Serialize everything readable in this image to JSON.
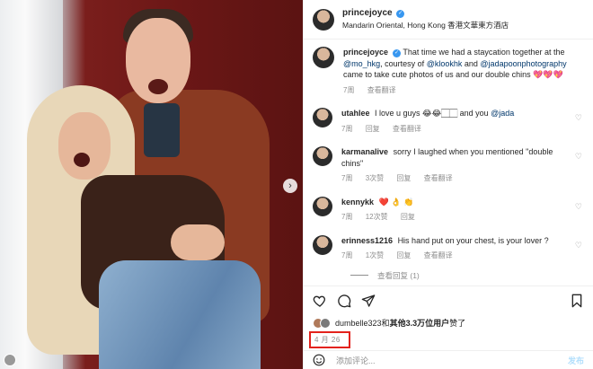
{
  "post": {
    "username": "princejoyce",
    "location": "Mandarin Oriental, Hong Kong 香港文華東方酒店"
  },
  "caption": {
    "username": "princejoyce",
    "text_a": "That time we had a staycation together at the",
    "mention_1": "@mo_hkg",
    "text_b": ", courtesy of",
    "mention_2": "@klookhk",
    "text_c": "and",
    "mention_3": "@jadapoonphotography",
    "text_d": "came to take cute photos of us and our double chins 💖💖💖",
    "time": "7周",
    "translate": "查看翻译"
  },
  "comments": [
    {
      "username": "utahlee",
      "text": "I love u guys 😂😂🏻🏻 and you",
      "mention": "@jada",
      "time": "7周",
      "reply": "回复",
      "translate": "查看翻译"
    },
    {
      "username": "karmanalive",
      "text": "sorry I laughed when you mentioned \"double chins\"",
      "time": "7周",
      "likes": "3次赞",
      "reply": "回复",
      "translate": "查看翻译"
    },
    {
      "username": "kennykk",
      "text": "❤️ 👌 👏",
      "time": "7周",
      "likes": "12次赞",
      "reply": "回复"
    },
    {
      "username": "erinness1216",
      "text": "His hand put on your chest, is your lover ?",
      "time": "7周",
      "likes": "1次赞",
      "reply": "回复",
      "translate": "查看翻译"
    }
  ],
  "more_replies": "查看回复 (1)",
  "likes": {
    "user": "dumbelle323",
    "mid": "和",
    "count": "其他3.3万位用户",
    "end": "赞了"
  },
  "date": "4 月 26",
  "add_comment": {
    "placeholder": "添加评论...",
    "post_label": "发布"
  },
  "icons": [
    "heart-icon",
    "comment-icon",
    "share-icon",
    "bookmark-icon",
    "emoji-icon",
    "chevron-right-icon"
  ],
  "colors": {
    "accent": "#3897f0",
    "highlight_box": "#e3221c",
    "mention": "#00376b"
  }
}
